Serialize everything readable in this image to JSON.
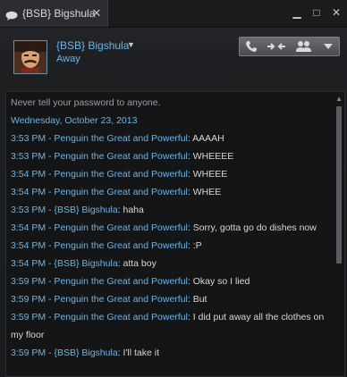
{
  "tab": {
    "title": "{BSB} Bigshula",
    "close": "✕"
  },
  "window_controls": {
    "minimize": "▁",
    "maximize": "□",
    "close": "✕"
  },
  "user": {
    "name": "{BSB} Bigshula",
    "status": "Away",
    "dropdown": "▼"
  },
  "actions": {
    "call_icon": "phone-icon",
    "voice_icon": "voice-chat-icon",
    "group_icon": "group-icon",
    "menu_icon": "chevron-down-icon"
  },
  "chat": {
    "system_notice": "Never tell your password to anyone.",
    "date": "Wednesday, October 23, 2013",
    "messages": [
      {
        "meta": "3:53 PM - Penguin the Great and Powerful",
        "text": ": AAAAH"
      },
      {
        "meta": "3:53 PM - Penguin the Great and Powerful",
        "text": ": WHEEEE"
      },
      {
        "meta": "3:54 PM - Penguin the Great and Powerful",
        "text": ": WHEEE"
      },
      {
        "meta": "3:54 PM - Penguin the Great and Powerful",
        "text": ": WHEE"
      },
      {
        "meta": "3:53 PM - {BSB} Bigshula",
        "text": ": haha"
      },
      {
        "meta": "3:54 PM - Penguin the Great and Powerful",
        "text": ": Sorry, gotta go do dishes now"
      },
      {
        "meta": "3:54 PM - Penguin the Great and Powerful",
        "text": ": :P"
      },
      {
        "meta": "3:54 PM - {BSB} Bigshula",
        "text": ": atta boy"
      },
      {
        "meta": "3:59 PM - Penguin the Great and Powerful",
        "text": ": Okay so I lied"
      },
      {
        "meta": "3:59 PM - Penguin the Great and Powerful",
        "text": ": But"
      },
      {
        "meta": "3:59 PM - Penguin the Great and Powerful",
        "text": ": I did put away all the clothes on my floor"
      },
      {
        "meta": "3:59 PM - {BSB} Bigshula",
        "text": ": I'll take it"
      }
    ]
  },
  "colors": {
    "accent_blue": "#6bb5e7",
    "message_text": "#d6d7d9",
    "system_text": "#9a9ea3",
    "background": "#141517"
  }
}
